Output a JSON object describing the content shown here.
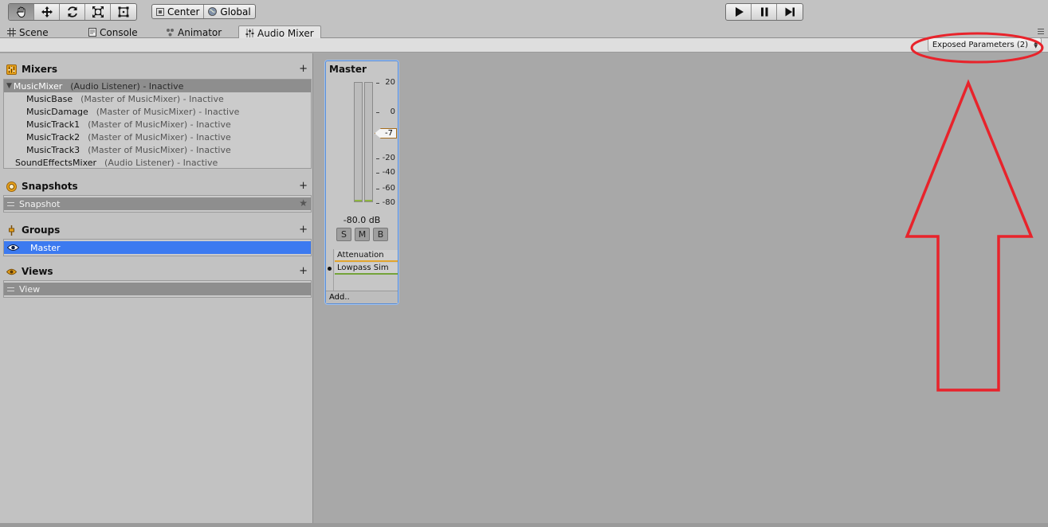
{
  "toolbar": {
    "tools": [
      "hand-tool",
      "move-tool",
      "rotate-tool",
      "scale-tool",
      "rect-tool"
    ],
    "pivot_mode": "Center",
    "pivot_rotation": "Global"
  },
  "tabs": [
    {
      "label": "Scene",
      "icon": "scene-icon"
    },
    {
      "label": "Console",
      "icon": "console-icon"
    },
    {
      "label": "Animator",
      "icon": "animator-icon"
    },
    {
      "label": "Audio Mixer",
      "icon": "audio-mixer-icon",
      "active": true
    }
  ],
  "header": {
    "exposed_parameters": "Exposed Parameters (2)"
  },
  "mixers": {
    "title": "Mixers",
    "add": "+",
    "items": [
      {
        "name": "MusicMixer",
        "info": "(Audio Listener) - Inactive"
      },
      {
        "name": "MusicBase",
        "info": "(Master of MusicMixer) - Inactive"
      },
      {
        "name": "MusicDamage",
        "info": "(Master of MusicMixer) - Inactive"
      },
      {
        "name": "MusicTrack1",
        "info": "(Master of MusicMixer) - Inactive"
      },
      {
        "name": "MusicTrack2",
        "info": "(Master of MusicMixer) - Inactive"
      },
      {
        "name": "MusicTrack3",
        "info": "(Master of MusicMixer) - Inactive"
      },
      {
        "name": "SoundEffectsMixer",
        "info": "(Audio Listener) - Inactive"
      }
    ]
  },
  "snapshots": {
    "title": "Snapshots",
    "add": "+",
    "items": [
      {
        "name": "Snapshot",
        "icon": "star-icon"
      }
    ]
  },
  "groups": {
    "title": "Groups",
    "add": "+",
    "items": [
      {
        "name": "Master",
        "icon": "eye-icon"
      }
    ]
  },
  "views": {
    "title": "Views",
    "add": "+",
    "items": [
      {
        "name": "View"
      }
    ]
  },
  "strip": {
    "title": "Master",
    "scale": [
      "20",
      "0",
      "-20",
      "-40",
      "-60",
      "-80"
    ],
    "fader_value": "-7",
    "db_readout": "-80.0 dB",
    "solo": "S",
    "mute": "M",
    "bypass": "B",
    "effects": [
      "Attenuation",
      "Lowpass Sim"
    ],
    "add": "Add.."
  },
  "colors": {
    "selection_blue": "#3c7af0",
    "annotation_red": "#e8232b",
    "attenuation_bar": "#e2a52e",
    "lowpass_bar": "#74a33a"
  }
}
